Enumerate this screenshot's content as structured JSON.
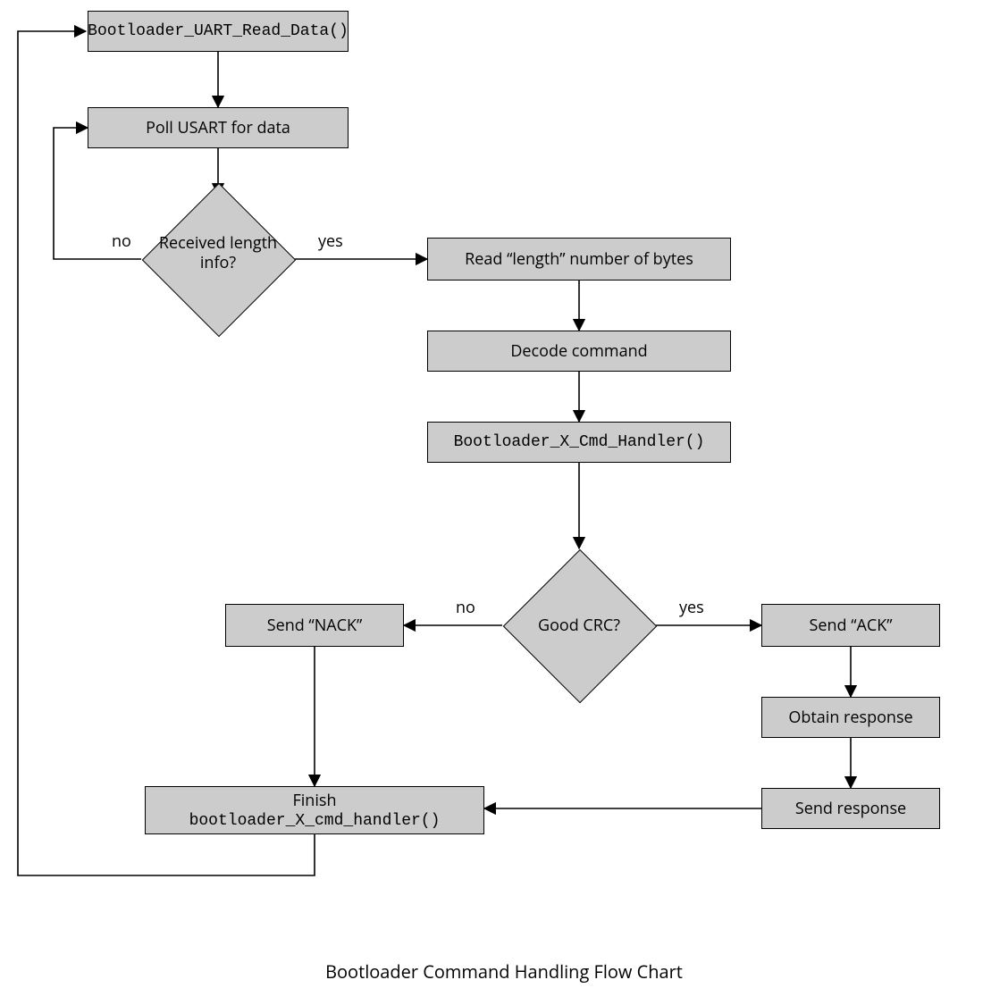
{
  "chart_data": {
    "type": "flowchart",
    "title": "Bootloader Command Handling Flow Chart",
    "nodes": [
      {
        "id": "read_data",
        "kind": "process",
        "label": "Bootloader_UART_Read_Data()",
        "mono": true
      },
      {
        "id": "poll",
        "kind": "process",
        "label": "Poll USART for data"
      },
      {
        "id": "recv_len",
        "kind": "decision",
        "label": "Received length info?"
      },
      {
        "id": "read_bytes",
        "kind": "process",
        "label": "Read “length” number of bytes"
      },
      {
        "id": "decode",
        "kind": "process",
        "label": "Decode command"
      },
      {
        "id": "handler",
        "kind": "process",
        "label": "Bootloader_X_Cmd_Handler()",
        "mono": true
      },
      {
        "id": "good_crc",
        "kind": "decision",
        "label": "Good CRC?"
      },
      {
        "id": "nack",
        "kind": "process",
        "label": "Send “NACK”"
      },
      {
        "id": "ack",
        "kind": "process",
        "label": "Send “ACK”"
      },
      {
        "id": "obtain",
        "kind": "process",
        "label": "Obtain response"
      },
      {
        "id": "send_resp",
        "kind": "process",
        "label": "Send response"
      },
      {
        "id": "finish",
        "kind": "process",
        "label_line1": "Finish",
        "label_line2": "bootloader_X_cmd_handler()"
      }
    ],
    "edges": [
      {
        "from": "read_data",
        "to": "poll"
      },
      {
        "from": "poll",
        "to": "recv_len"
      },
      {
        "from": "recv_len",
        "to": "poll",
        "label": "no"
      },
      {
        "from": "recv_len",
        "to": "read_bytes",
        "label": "yes"
      },
      {
        "from": "read_bytes",
        "to": "decode"
      },
      {
        "from": "decode",
        "to": "handler"
      },
      {
        "from": "handler",
        "to": "good_crc"
      },
      {
        "from": "good_crc",
        "to": "nack",
        "label": "no"
      },
      {
        "from": "good_crc",
        "to": "ack",
        "label": "yes"
      },
      {
        "from": "ack",
        "to": "obtain"
      },
      {
        "from": "obtain",
        "to": "send_resp"
      },
      {
        "from": "send_resp",
        "to": "finish"
      },
      {
        "from": "nack",
        "to": "finish"
      },
      {
        "from": "finish",
        "to": "read_data"
      }
    ]
  },
  "labels": {
    "no": "no",
    "yes": "yes"
  }
}
